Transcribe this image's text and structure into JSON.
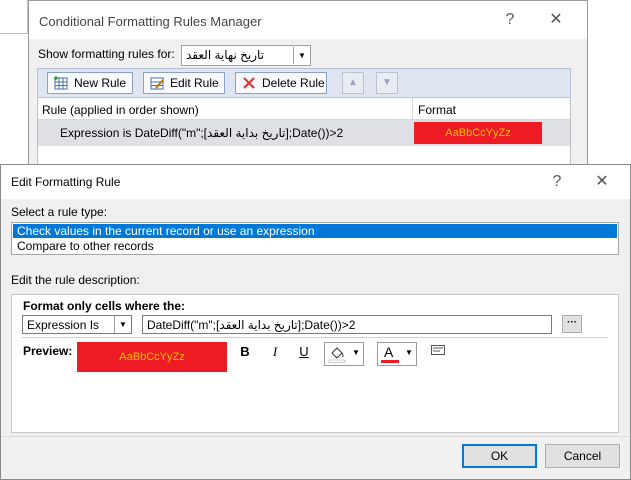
{
  "manager": {
    "title": "Conditional Formatting Rules Manager",
    "help_glyph": "?",
    "close_glyph": "✕",
    "show_rules_label": "Show formatting rules for:",
    "show_rules_value": "تاريخ نهاية العقد",
    "new_rule": "New Rule",
    "edit_rule": "Edit Rule",
    "delete_rule": "Delete Rule",
    "col_rule": "Rule (applied in order shown)",
    "col_format": "Format",
    "rule_text": "Expression is DateDiff(\"m\";[تاريخ بداية العقد];Date())>2",
    "format_sample": "AaBbCcYyZz"
  },
  "edit": {
    "title": "Edit Formatting Rule",
    "help_glyph": "?",
    "close_glyph": "✕",
    "select_type_label": "Select a rule type:",
    "rule_types": [
      "Check values in the current record or use an expression",
      "Compare to other records"
    ],
    "edit_desc_label": "Edit the rule description:",
    "format_only_label": "Format only cells where the:",
    "condition_type": "Expression Is",
    "expression": "DateDiff(\"m\";[تاريخ بداية العقد];Date())>2",
    "builder_glyph": "···",
    "preview_label": "Preview:",
    "preview_sample": "AaBbCcYyZz",
    "bold": "B",
    "italic": "I",
    "underline": "U",
    "font_color_glyph": "A",
    "ok": "OK",
    "cancel": "Cancel"
  },
  "colors": {
    "selection": "#0078d7",
    "preview_bg": "#ed1c24",
    "preview_fg": "#ffc000",
    "ok_border": "#0078d7"
  }
}
